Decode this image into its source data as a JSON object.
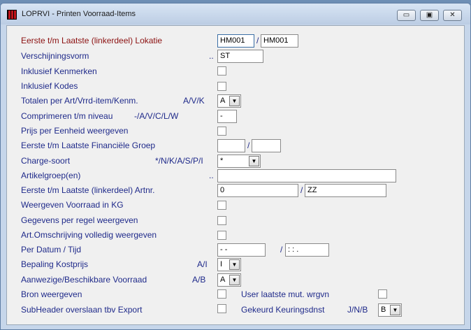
{
  "window": {
    "title": "LOPRVI - Printen Voorraad-Items",
    "minimize_glyph": "▭",
    "restore_glyph": "▣",
    "close_glyph": "✕"
  },
  "colors": {
    "label": "#1f2a8a",
    "label_highlight": "#8b1010",
    "client_bg": "#f0f0f0",
    "frame": "#c6d6ea"
  },
  "form": {
    "lokatie": {
      "label": "Eerste t/m Laatste (linkerdeel) Lokatie",
      "from": "HM001",
      "sep": "/",
      "to": "HM001"
    },
    "verschijningsvorm": {
      "label": "Verschijningsvorm",
      "code": "..",
      "value": "ST"
    },
    "inkl_kenmerken": {
      "label": "Inklusief Kenmerken"
    },
    "inkl_kodes": {
      "label": "Inklusief Kodes"
    },
    "totalen": {
      "label": "Totalen per Art/Vrrd-item/Kenm.",
      "code": "A/V/K",
      "value": "A"
    },
    "comprimeren": {
      "label": "Comprimeren t/m niveau",
      "code": "-/A/V/C/L/W",
      "value": "-"
    },
    "prijs": {
      "label": "Prijs per Eenheid weergeven"
    },
    "fin_groep": {
      "label": "Eerste t/m Laatste Financiële Groep",
      "from": "",
      "sep": "/",
      "to": ""
    },
    "charge": {
      "label": "Charge-soort",
      "code": "*/N/K/A/S/P/I",
      "value": "*"
    },
    "artikelgroep": {
      "label": "Artikelgroep(en)",
      "code": "..",
      "value": ""
    },
    "artnr": {
      "label": "Eerste t/m Laatste (linkerdeel) Artnr.",
      "from": "0",
      "sep": "/",
      "to": "ZZ"
    },
    "voorraad_kg": {
      "label": "Weergeven Voorraad in KG"
    },
    "per_regel": {
      "label": "Gegevens per regel weergeven"
    },
    "omschrijving": {
      "label": "Art.Omschrijving volledig weergeven"
    },
    "datum": {
      "label": "Per Datum / Tijd",
      "date": " - -",
      "sep": "/",
      "time": " : : ."
    },
    "kostprijs": {
      "label": "Bepaling Kostprijs",
      "code": "A/I",
      "value": "I"
    },
    "aanwezige": {
      "label": "Aanwezige/Beschikbare Voorraad",
      "code": "A/B",
      "value": "A"
    },
    "bron": {
      "label": "Bron weergeven"
    },
    "user_mut": {
      "label": "User laatste mut. wrgvn"
    },
    "subheader": {
      "label": "SubHeader overslaan tbv Export"
    },
    "gekeurd": {
      "label": "Gekeurd Keuringsdnst",
      "code": "J/N/B",
      "value": "B"
    },
    "arrow_glyph": "▼"
  }
}
